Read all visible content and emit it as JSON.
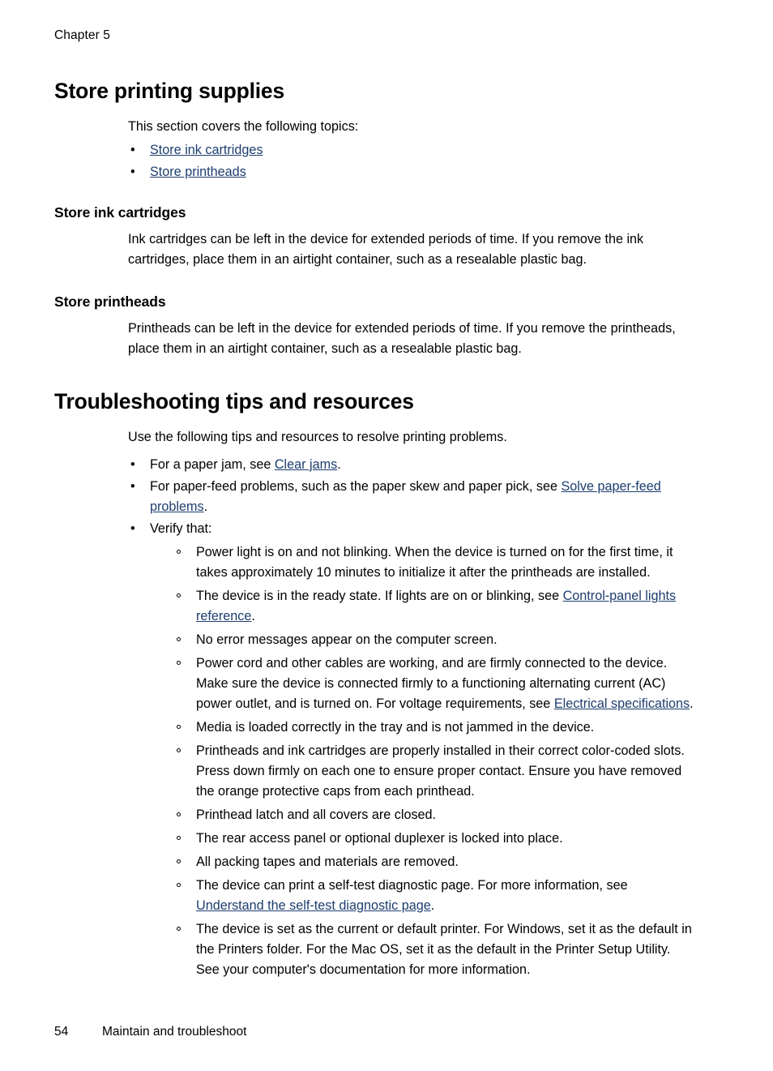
{
  "header": {
    "chapter_label": "Chapter 5"
  },
  "footer": {
    "page_number": "54",
    "running_title": "Maintain and troubleshoot"
  },
  "colors": {
    "link": "#1d3d6e",
    "text": "#000000",
    "page_background": "#ffffff"
  },
  "sections": [
    {
      "title": "Store printing supplies",
      "intro": "This section covers the following topics:",
      "toc_links": [
        {
          "label": "Store ink cartridges"
        },
        {
          "label": "Store printheads"
        }
      ],
      "subsections": [
        {
          "title": "Store ink cartridges",
          "body": "Ink cartridges can be left in the device for extended periods of time. If you remove the ink cartridges, place them in an airtight container, such as a resealable plastic bag."
        },
        {
          "title": "Store printheads",
          "body": "Printheads can be left in the device for extended periods of time. If you remove the printheads, place them in an airtight container, such as a resealable plastic bag."
        }
      ]
    },
    {
      "title": "Troubleshooting tips and resources",
      "intro": "Use the following tips and resources to resolve printing problems.",
      "bullets": [
        {
          "marker": "•",
          "parts": [
            {
              "type": "text",
              "value": "For a paper jam, see "
            },
            {
              "type": "link",
              "value": "Clear jams"
            },
            {
              "type": "text",
              "value": "."
            }
          ]
        },
        {
          "marker": "•",
          "parts": [
            {
              "type": "text",
              "value": "For paper-feed problems, such as the paper skew and paper pick, see "
            },
            {
              "type": "link",
              "value": "Solve paper-feed problems"
            },
            {
              "type": "text",
              "value": "."
            }
          ]
        },
        {
          "marker": "•",
          "parts": [
            {
              "type": "text",
              "value": "Verify that:"
            }
          ],
          "subbullets": [
            {
              "marker": "◦",
              "parts": [
                {
                  "type": "text",
                  "value": "Power light is on and not blinking. When the device is turned on for the first time, it takes approximately 10 minutes to initialize it after the printheads are installed."
                }
              ]
            },
            {
              "marker": "◦",
              "parts": [
                {
                  "type": "text",
                  "value": "The device is in the ready state. If lights are on or blinking, see "
                },
                {
                  "type": "link",
                  "value": "Control-panel lights reference"
                },
                {
                  "type": "text",
                  "value": "."
                }
              ]
            },
            {
              "marker": "◦",
              "parts": [
                {
                  "type": "text",
                  "value": "No error messages appear on the computer screen."
                }
              ]
            },
            {
              "marker": "◦",
              "parts": [
                {
                  "type": "text",
                  "value": "Power cord and other cables are working, and are firmly connected to the device. Make sure the device is connected firmly to a functioning alternating current (AC) power outlet, and is turned on. For voltage requirements, see "
                },
                {
                  "type": "link",
                  "value": "Electrical specifications"
                },
                {
                  "type": "text",
                  "value": "."
                }
              ]
            },
            {
              "marker": "◦",
              "parts": [
                {
                  "type": "text",
                  "value": "Media is loaded correctly in the tray and is not jammed in the device."
                }
              ]
            },
            {
              "marker": "◦",
              "parts": [
                {
                  "type": "text",
                  "value": "Printheads and ink cartridges are properly installed in their correct color-coded slots. Press down firmly on each one to ensure proper contact. Ensure you have removed the orange protective caps from each printhead."
                }
              ]
            },
            {
              "marker": "◦",
              "parts": [
                {
                  "type": "text",
                  "value": "Printhead latch and all covers are closed."
                }
              ]
            },
            {
              "marker": "◦",
              "parts": [
                {
                  "type": "text",
                  "value": "The rear access panel or optional duplexer is locked into place."
                }
              ]
            },
            {
              "marker": "◦",
              "parts": [
                {
                  "type": "text",
                  "value": "All packing tapes and materials are removed."
                }
              ]
            },
            {
              "marker": "◦",
              "parts": [
                {
                  "type": "text",
                  "value": "The device can print a self-test diagnostic page. For more information, see "
                },
                {
                  "type": "link",
                  "value": "Understand the self-test diagnostic page"
                },
                {
                  "type": "text",
                  "value": "."
                }
              ]
            },
            {
              "marker": "◦",
              "parts": [
                {
                  "type": "text",
                  "value": "The device is set as the current or default printer. For Windows, set it as the default in the Printers folder. For the Mac OS, set it as the default in the Printer Setup Utility. See your computer's documentation for more information."
                }
              ]
            }
          ]
        }
      ]
    }
  ]
}
